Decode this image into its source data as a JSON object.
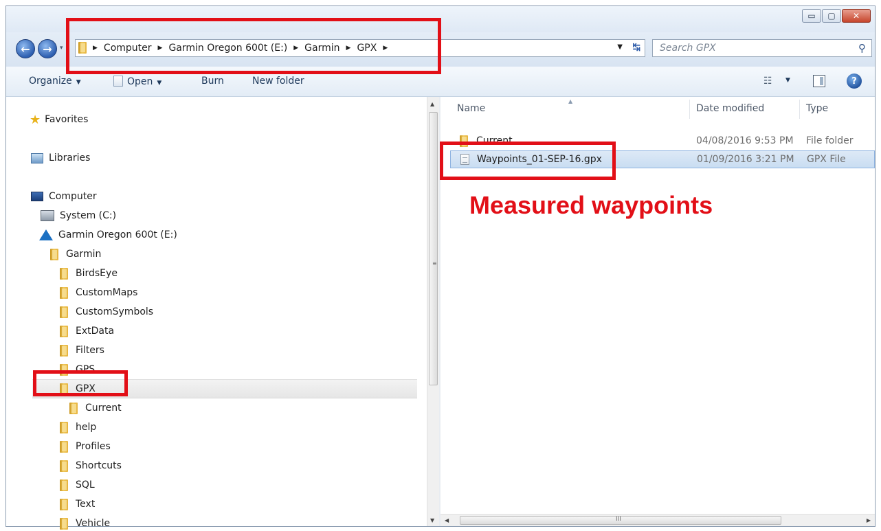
{
  "window": {
    "controls": {
      "minimize": "▭",
      "maximize": "▢",
      "close": "✕"
    }
  },
  "address_bar": {
    "crumbs": [
      "Computer",
      "Garmin Oregon 600t (E:)",
      "Garmin",
      "GPX"
    ],
    "separator": "▶"
  },
  "search": {
    "placeholder": "Search GPX"
  },
  "toolbar": {
    "organize": "Organize",
    "open": "Open",
    "burn": "Burn",
    "new_folder": "New folder"
  },
  "nav_pane": {
    "favorites": "Favorites",
    "libraries": "Libraries",
    "computer": "Computer",
    "system_drive": "System (C:)",
    "garmin_drive": "Garmin Oregon 600t (E:)",
    "garmin_folder": "Garmin",
    "subfolders": [
      "BirdsEye",
      "CustomMaps",
      "CustomSymbols",
      "ExtData",
      "Filters",
      "GPS",
      "GPX"
    ],
    "gpx_child": "Current",
    "more_folders": [
      "help",
      "Profiles",
      "Shortcuts",
      "SQL",
      "Text",
      "Vehicle"
    ],
    "selected": "GPX"
  },
  "file_list": {
    "columns": {
      "name": "Name",
      "date": "Date modified",
      "type": "Type"
    },
    "rows": [
      {
        "name": "Current",
        "date": "04/08/2016 9:53 PM",
        "type": "File folder",
        "icon": "folder-icon"
      },
      {
        "name": "Waypoints_01-SEP-16.gpx",
        "date": "01/09/2016 3:21 PM",
        "type": "GPX File",
        "icon": "file-icon"
      }
    ]
  },
  "scrollbar": {
    "grip_v": "≡",
    "grip_h": "III"
  },
  "annotation": {
    "text": "Measured waypoints",
    "color": "#e20f17"
  }
}
